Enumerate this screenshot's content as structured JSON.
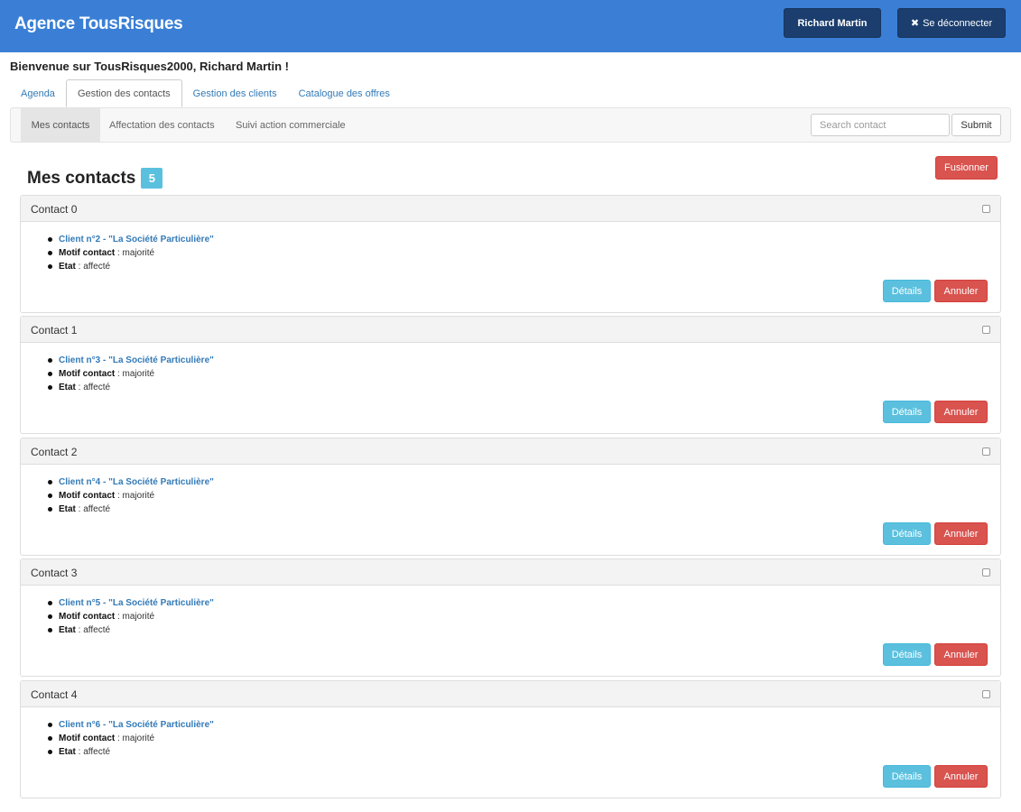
{
  "header": {
    "brand": "Agence TousRisques",
    "user_label": "Richard Martin",
    "logout_label": "Se déconnecter"
  },
  "welcome": "Bienvenue sur TousRisques2000, Richard Martin !",
  "tabs": [
    {
      "label": "Agenda"
    },
    {
      "label": "Gestion des contacts"
    },
    {
      "label": "Gestion des clients"
    },
    {
      "label": "Catalogue des offres"
    }
  ],
  "subnav": {
    "items": [
      {
        "label": "Mes contacts"
      },
      {
        "label": "Affectation des contacts"
      },
      {
        "label": "Suivi action commerciale"
      }
    ],
    "search_placeholder": "Search contact",
    "submit_label": "Submit"
  },
  "main": {
    "title": "Mes contacts",
    "count": "5",
    "merge_label": "Fusionner"
  },
  "contacts": [
    {
      "title": "Contact 0",
      "client": "Client n°2 - \"La Société Particulière\"",
      "motif_key": "Motif contact",
      "motif_value": " : majorité",
      "etat_key": "Etat",
      "etat_value": " : affecté",
      "details_label": "Détails",
      "cancel_label": "Annuler"
    },
    {
      "title": "Contact 1",
      "client": "Client n°3 - \"La Société Particulière\"",
      "motif_key": "Motif contact",
      "motif_value": " : majorité",
      "etat_key": "Etat",
      "etat_value": " : affecté",
      "details_label": "Détails",
      "cancel_label": "Annuler"
    },
    {
      "title": "Contact 2",
      "client": "Client n°4 - \"La Société Particulière\"",
      "motif_key": "Motif contact",
      "motif_value": " : majorité",
      "etat_key": "Etat",
      "etat_value": " : affecté",
      "details_label": "Détails",
      "cancel_label": "Annuler"
    },
    {
      "title": "Contact 3",
      "client": "Client n°5 - \"La Société Particulière\"",
      "motif_key": "Motif contact",
      "motif_value": " : majorité",
      "etat_key": "Etat",
      "etat_value": " : affecté",
      "details_label": "Détails",
      "cancel_label": "Annuler"
    },
    {
      "title": "Contact 4",
      "client": "Client n°6 - \"La Société Particulière\"",
      "motif_key": "Motif contact",
      "motif_value": " : majorité",
      "etat_key": "Etat",
      "etat_value": " : affecté",
      "details_label": "Détails",
      "cancel_label": "Annuler"
    }
  ]
}
